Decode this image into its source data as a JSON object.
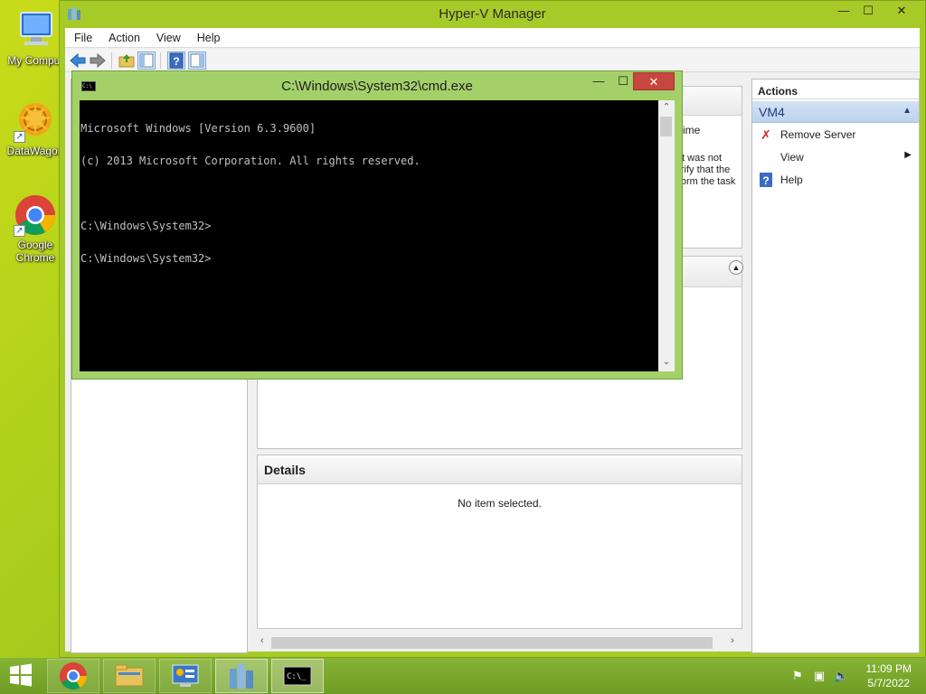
{
  "desktop": {
    "icons": [
      {
        "label": "My Comput",
        "icon": "computer-icon"
      },
      {
        "label": "DataWagon",
        "icon": "datawagon-icon"
      },
      {
        "label": "Google Chrome",
        "icon": "chrome-icon"
      }
    ]
  },
  "hyperv": {
    "title": "Hyper-V Manager",
    "controls": {
      "minimize": "—",
      "maximize": "☐",
      "close": "✕"
    },
    "menu": [
      "File",
      "Action",
      "View",
      "Help"
    ],
    "vm_column_header": "ptime",
    "vm_message": [
      "ject was not",
      "Verify that the",
      "erform the task"
    ],
    "details": {
      "title": "Details",
      "empty_text": "No item selected."
    },
    "actions": {
      "header": "Actions",
      "group": "VM4",
      "items": [
        {
          "label": "Remove Server",
          "icon": "remove-icon"
        },
        {
          "label": "View",
          "icon": "",
          "submenu": true
        },
        {
          "label": "Help",
          "icon": "help-icon"
        }
      ]
    }
  },
  "cmd": {
    "title": "C:\\Windows\\System32\\cmd.exe",
    "icon_text": "C:\\",
    "controls": {
      "minimize": "—",
      "maximize": "☐",
      "close": "✕"
    },
    "lines": [
      "Microsoft Windows [Version 6.3.9600]",
      "(c) 2013 Microsoft Corporation. All rights reserved.",
      "",
      "C:\\Windows\\System32>",
      "C:\\Windows\\System32>"
    ]
  },
  "taskbar": {
    "apps": [
      {
        "name": "chrome",
        "icon": "chrome-icon"
      },
      {
        "name": "file-explorer",
        "icon": "folder-icon"
      },
      {
        "name": "control-panel",
        "icon": "control-panel-icon"
      },
      {
        "name": "hyper-v-manager",
        "icon": "hyperv-icon"
      },
      {
        "name": "cmd",
        "icon": "cmd-icon"
      }
    ],
    "clock": {
      "time": "11:09 PM",
      "date": "5/7/2022"
    }
  }
}
